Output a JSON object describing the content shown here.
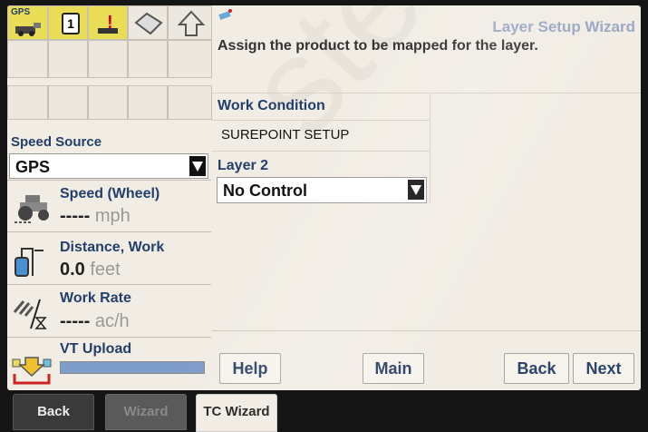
{
  "status_bar": {
    "gps_label": "GPS",
    "section_count": "1"
  },
  "left_panel": {
    "speed_source_label": "Speed Source",
    "speed_source_value": "GPS",
    "speed_title": "Speed (Wheel)",
    "speed_value": "-----",
    "speed_unit": "mph",
    "distance_title": "Distance, Work",
    "distance_value": "0.0",
    "distance_unit": "feet",
    "work_rate_title": "Work Rate",
    "work_rate_value": "-----",
    "work_rate_unit": "ac/h",
    "vt_upload_title": "VT Upload"
  },
  "wizard": {
    "title": "Layer Setup Wizard",
    "instruction": "Assign the product to be mapped for the layer.",
    "work_condition_label": "Work Condition",
    "work_condition_value": "SUREPOINT SETUP",
    "layer_label": "Layer 2",
    "layer_value": "No Control"
  },
  "buttons": {
    "help": "Help",
    "main": "Main",
    "back": "Back",
    "next": "Next"
  },
  "soft_tabs": {
    "back": "Back",
    "wizard": "Wizard",
    "tc_wizard": "TC Wizard"
  },
  "watermark": "stems",
  "colors": {
    "accent_text": "#223f6b",
    "status_yellow": "#e9dc56",
    "screen_bg": "#f1ede5"
  }
}
